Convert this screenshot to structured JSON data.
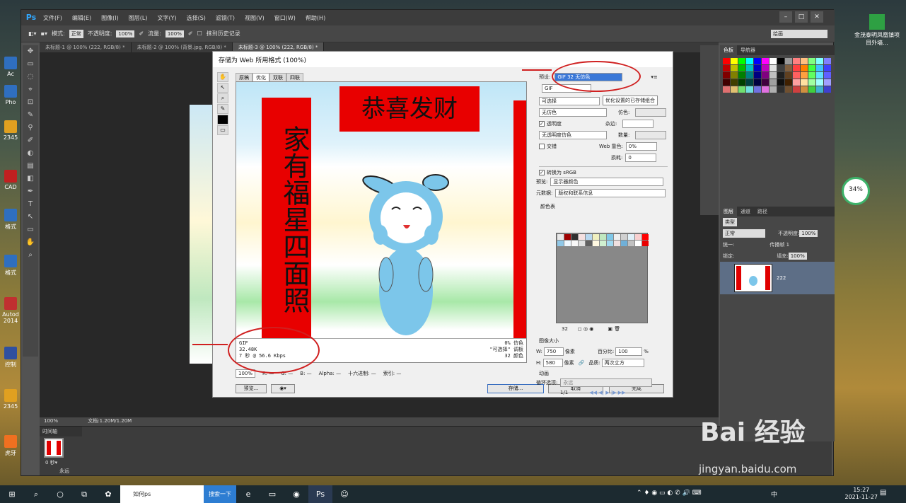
{
  "desktop": {
    "icons": [
      "Ac",
      "Pho",
      "2345",
      "CAD",
      "格式",
      "格式",
      "Autod 2014",
      "控制",
      "2345",
      "虎牙"
    ],
    "right_label": "金茂泰明凤凰镇项目外墙..."
  },
  "ps": {
    "title": "Ps",
    "menu": [
      "文件(F)",
      "编辑(E)",
      "图像(I)",
      "图层(L)",
      "文字(Y)",
      "选择(S)",
      "滤镜(T)",
      "视图(V)",
      "窗口(W)",
      "帮助(H)"
    ],
    "options": {
      "mode_label": "模式:",
      "mode_value": "正常",
      "opacity_label": "不透明度:",
      "opacity_value": "100%",
      "flow_label": "流量:",
      "flow_value": "100%",
      "history": "抹到历史记录",
      "workspace": "绘画"
    },
    "tabs": [
      "未标题-1 @ 100% (222, RGB/8) *",
      "未标题-2 @ 100% (背景.jpg, RGB/8) *",
      "未标题-3 @ 100% (222, RGB/8) *"
    ],
    "tools": [
      "✥",
      "▭",
      "◌",
      "⌖",
      "⊡",
      "✎",
      "⚲",
      "✐",
      "◐",
      "▤",
      "◧",
      "✒",
      "T",
      "↖",
      "▭",
      "✋",
      "⌕"
    ],
    "status": {
      "zoom": "100%",
      "doc": "文档:1.20M/1.20M"
    },
    "timeline": {
      "title": "时间轴",
      "frame_time": "0 秒▾",
      "loop": "永远"
    },
    "panels": {
      "color_tabs": [
        "色板",
        "导航器"
      ],
      "layer_tabs": [
        "图层",
        "通道",
        "路径"
      ],
      "kind": "类型",
      "blend": "正常",
      "opacity_label": "不透明度:",
      "opacity": "100%",
      "lock": "锁定:",
      "fill_label": "填充:",
      "fill": "100%",
      "unify": "统一:",
      "propagate": "传播帧 1",
      "layer_name": "222"
    }
  },
  "dialog": {
    "title": "存储为 Web 所用格式 (100%)",
    "tabs": [
      "原稿",
      "优化",
      "双联",
      "四联"
    ],
    "preview": {
      "couplet_top": "恭喜发财",
      "couplet_left": "家有福星四面照",
      "format": "GIF",
      "size": "32.48K",
      "time": "7 秒 @ 56.6 Kbps",
      "dither": "0% 仿色",
      "palette": "\"可选择\" 调板",
      "colors": "32 颜色"
    },
    "settings": {
      "preset_label": "预设:",
      "preset": "GIF 32 无仿色",
      "tooltip": "优化设置的已存储组合",
      "format": "GIF",
      "reduction": "可选择",
      "dither_algo": "无仿色",
      "dither_label": "仿色:",
      "transparency": "透明度",
      "matte_label": "杂边:",
      "trans_dither": "无透明度仿色",
      "amount_label": "数量:",
      "interlaced": "交错",
      "websnap_label": "Web 靠色:",
      "websnap": "0%",
      "lossy_label": "损耗:",
      "lossy": "0",
      "convert": "转换为 sRGB",
      "preview_label": "预览:",
      "preview_value": "显示器颜色",
      "meta_label": "元数据:",
      "meta_value": "版权和联系信息",
      "colortable_label": "颜色表",
      "count": "32",
      "imagesize": "图像大小",
      "w_label": "W:",
      "w": "750",
      "h_label": "H:",
      "h": "580",
      "px": "像素",
      "percent_label": "百分比:",
      "percent": "100",
      "quality_label": "品质:",
      "quality": "两次立方",
      "anim": "动画",
      "loop_label": "循环选项:",
      "loop": "永远",
      "frame": "1/1"
    },
    "bottom": {
      "zoom": "100%",
      "r": "R: —",
      "g": "G: —",
      "b": "B: —",
      "alpha": "Alpha: —",
      "hex": "十六进制: —",
      "index": "索引: —"
    },
    "buttons": {
      "preview": "预览...",
      "save": "存储...",
      "cancel": "取消",
      "done": "完成"
    }
  },
  "swatch_colors": [
    "#ff0000",
    "#ffff00",
    "#00ff00",
    "#00ffff",
    "#0000ff",
    "#ff00ff",
    "#ffffff",
    "#000000",
    "#999999",
    "#ff8080",
    "#ffbf80",
    "#80ff80",
    "#80ffff",
    "#8080ff",
    "#c00000",
    "#c0c000",
    "#00c000",
    "#00c0c0",
    "#0000c0",
    "#c000c0",
    "#e0e0e0",
    "#404040",
    "#806040",
    "#ff4040",
    "#ff8000",
    "#40ff40",
    "#40c0ff",
    "#4040ff",
    "#800000",
    "#808000",
    "#008000",
    "#008080",
    "#000080",
    "#800080",
    "#c0c0c0",
    "#202020",
    "#604020",
    "#ff6060",
    "#ffa040",
    "#60ff60",
    "#60e0ff",
    "#6060ff",
    "#400000",
    "#404000",
    "#004000",
    "#004040",
    "#000040",
    "#400040",
    "#a0a0a0",
    "#101010",
    "#402000",
    "#ffa0a0",
    "#ffe0a0",
    "#a0ffa0",
    "#a0ffff",
    "#a0a0ff",
    "#e07070",
    "#e0c070",
    "#70e070",
    "#70e0e0",
    "#7070e0",
    "#e070e0",
    "#b0b0b0",
    "#303030",
    "#705030",
    "#d04040",
    "#d09040",
    "#40d040",
    "#40b0d0",
    "#4040d0"
  ],
  "colortable_colors": [
    "#e8e8e8",
    "#a00000",
    "#303030",
    "#f5e0e0",
    "#b8d8f0",
    "#f0f0c0",
    "#c0e8c0",
    "#80c8e8",
    "#f0f0f0",
    "#d0d0d0",
    "#e0f0f8",
    "#f8d0d0",
    "#ff0000",
    "#90c8e8",
    "#f0f8ff",
    "#f8f8f8",
    "#e0e0e0",
    "#606060",
    "#fff8e0",
    "#d0f0d0",
    "#a0d8f0",
    "#f0e0e0",
    "#70b0d8",
    "#c0c0c0",
    "#ffffff",
    "#e80000"
  ],
  "taskbar": {
    "search_text": "如何ps",
    "search_btn": "搜索一下",
    "time": "15:27",
    "date": "2021-11-27",
    "lang": "中"
  },
  "perf": "34%",
  "watermark": "Bai 经验",
  "watermark_url": "jingyan.baidu.com"
}
